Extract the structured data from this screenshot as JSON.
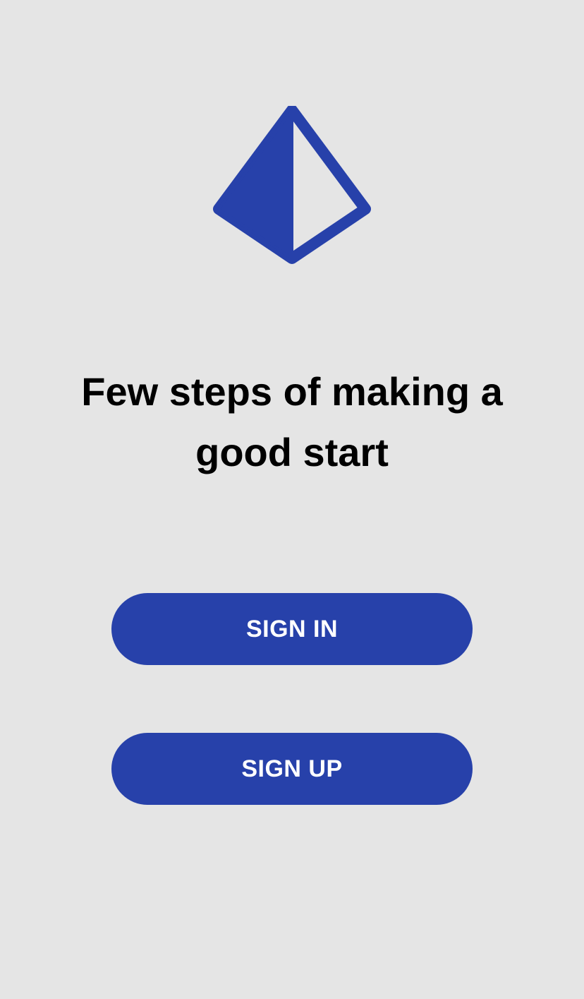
{
  "theme": {
    "background": "#e5e5e5",
    "accent": "#2741aa",
    "text": "#000000",
    "button_text": "#ffffff"
  },
  "logo": {
    "icon": "prism-icon"
  },
  "headline": "Few steps of making a good start",
  "actions": {
    "sign_in_label": "SIGN IN",
    "sign_up_label": "SIGN UP"
  }
}
